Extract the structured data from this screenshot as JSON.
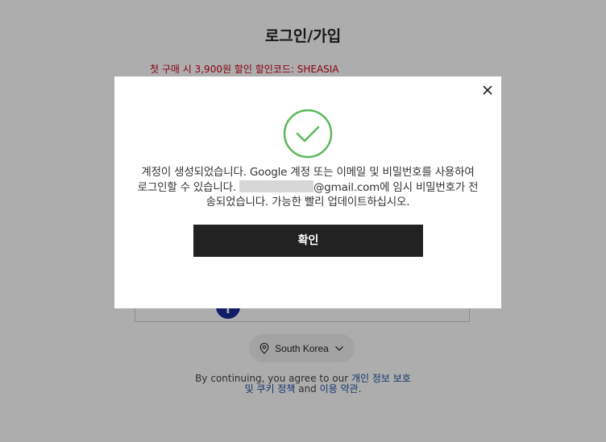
{
  "page": {
    "title": "로그인/가입",
    "promo": "첫 구매 시 3,900원 할인 할인코드: SHEASIA",
    "facebook_label": "f",
    "region": {
      "label": "South Korea",
      "icon": "location-pin-icon",
      "chevron_icon": "chevron-down-icon"
    },
    "terms": {
      "prefix": "By continuing, you agree to our ",
      "privacy_link": "개인 정보 보호 및 쿠키 정책",
      "conjunction": " and ",
      "terms_link": "이용 약관",
      "suffix": "."
    }
  },
  "modal": {
    "close_icon": "close-icon",
    "success_icon": "check-circle-icon",
    "message_line1": "계정이 생성되었습니다. Google 계정 또는 이메일 및 비밀번호를 사용하여",
    "message_line2_prefix": "로그인할 수 있습니다. ",
    "email_suffix": "@gmail.com",
    "message_line2_suffix": "에 임시 비밀번호가 전",
    "message_line3": "송되었습니다. 가능한 빨리 업데이트하십시오.",
    "confirm_label": "확인"
  },
  "colors": {
    "overlay": "rgba(0,0,0,0.32)",
    "success_green": "#5cb85c",
    "promo_red": "#d0021b",
    "button_dark": "#222222",
    "link_blue": "#1e4fa1"
  }
}
